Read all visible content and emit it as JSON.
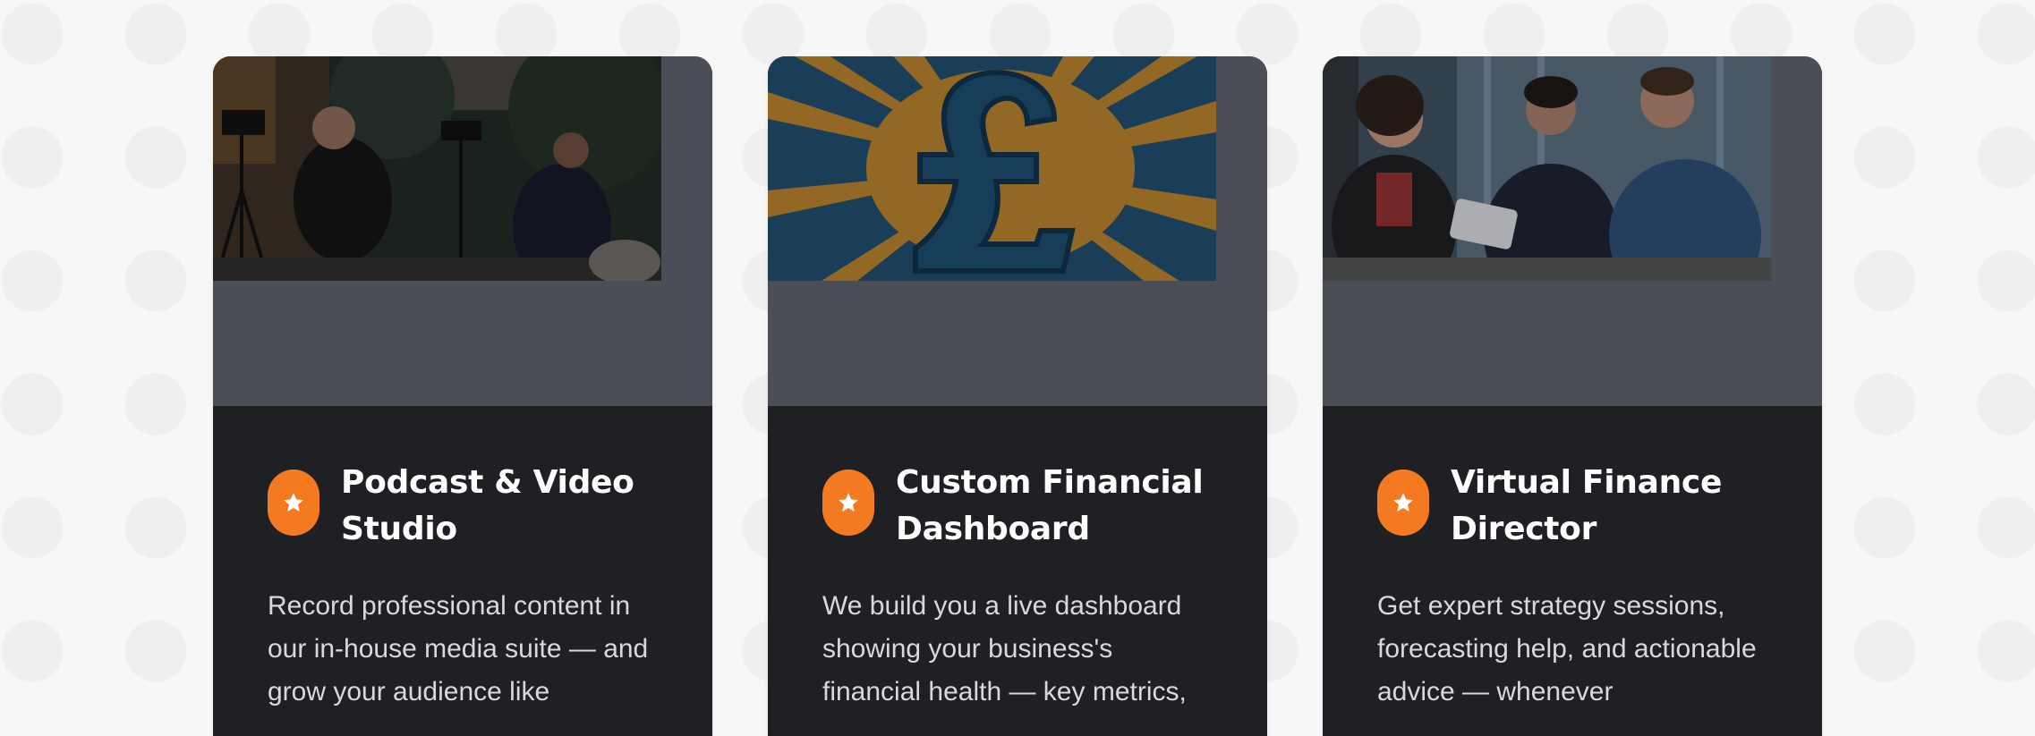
{
  "cards": [
    {
      "title": "Podcast & Video Studio",
      "description": "Record professional content in our in-house media suite — and grow your audience like",
      "icon": "star-icon",
      "image": "podcast-studio-photo"
    },
    {
      "title": "Custom Financial Dashboard",
      "description": "We build you a live dashboard showing your business's financial health — key metrics,",
      "icon": "star-icon",
      "image": "pound-sign-illustration"
    },
    {
      "title": "Virtual Finance Director",
      "description": "Get expert strategy sessions, forecasting help, and actionable advice — whenever",
      "icon": "star-icon",
      "image": "business-meeting-photo"
    }
  ],
  "colors": {
    "accent": "#f47a22",
    "card_background": "#1f2024",
    "media_background": "#4b4e56",
    "page_background": "#f7f7f8"
  }
}
